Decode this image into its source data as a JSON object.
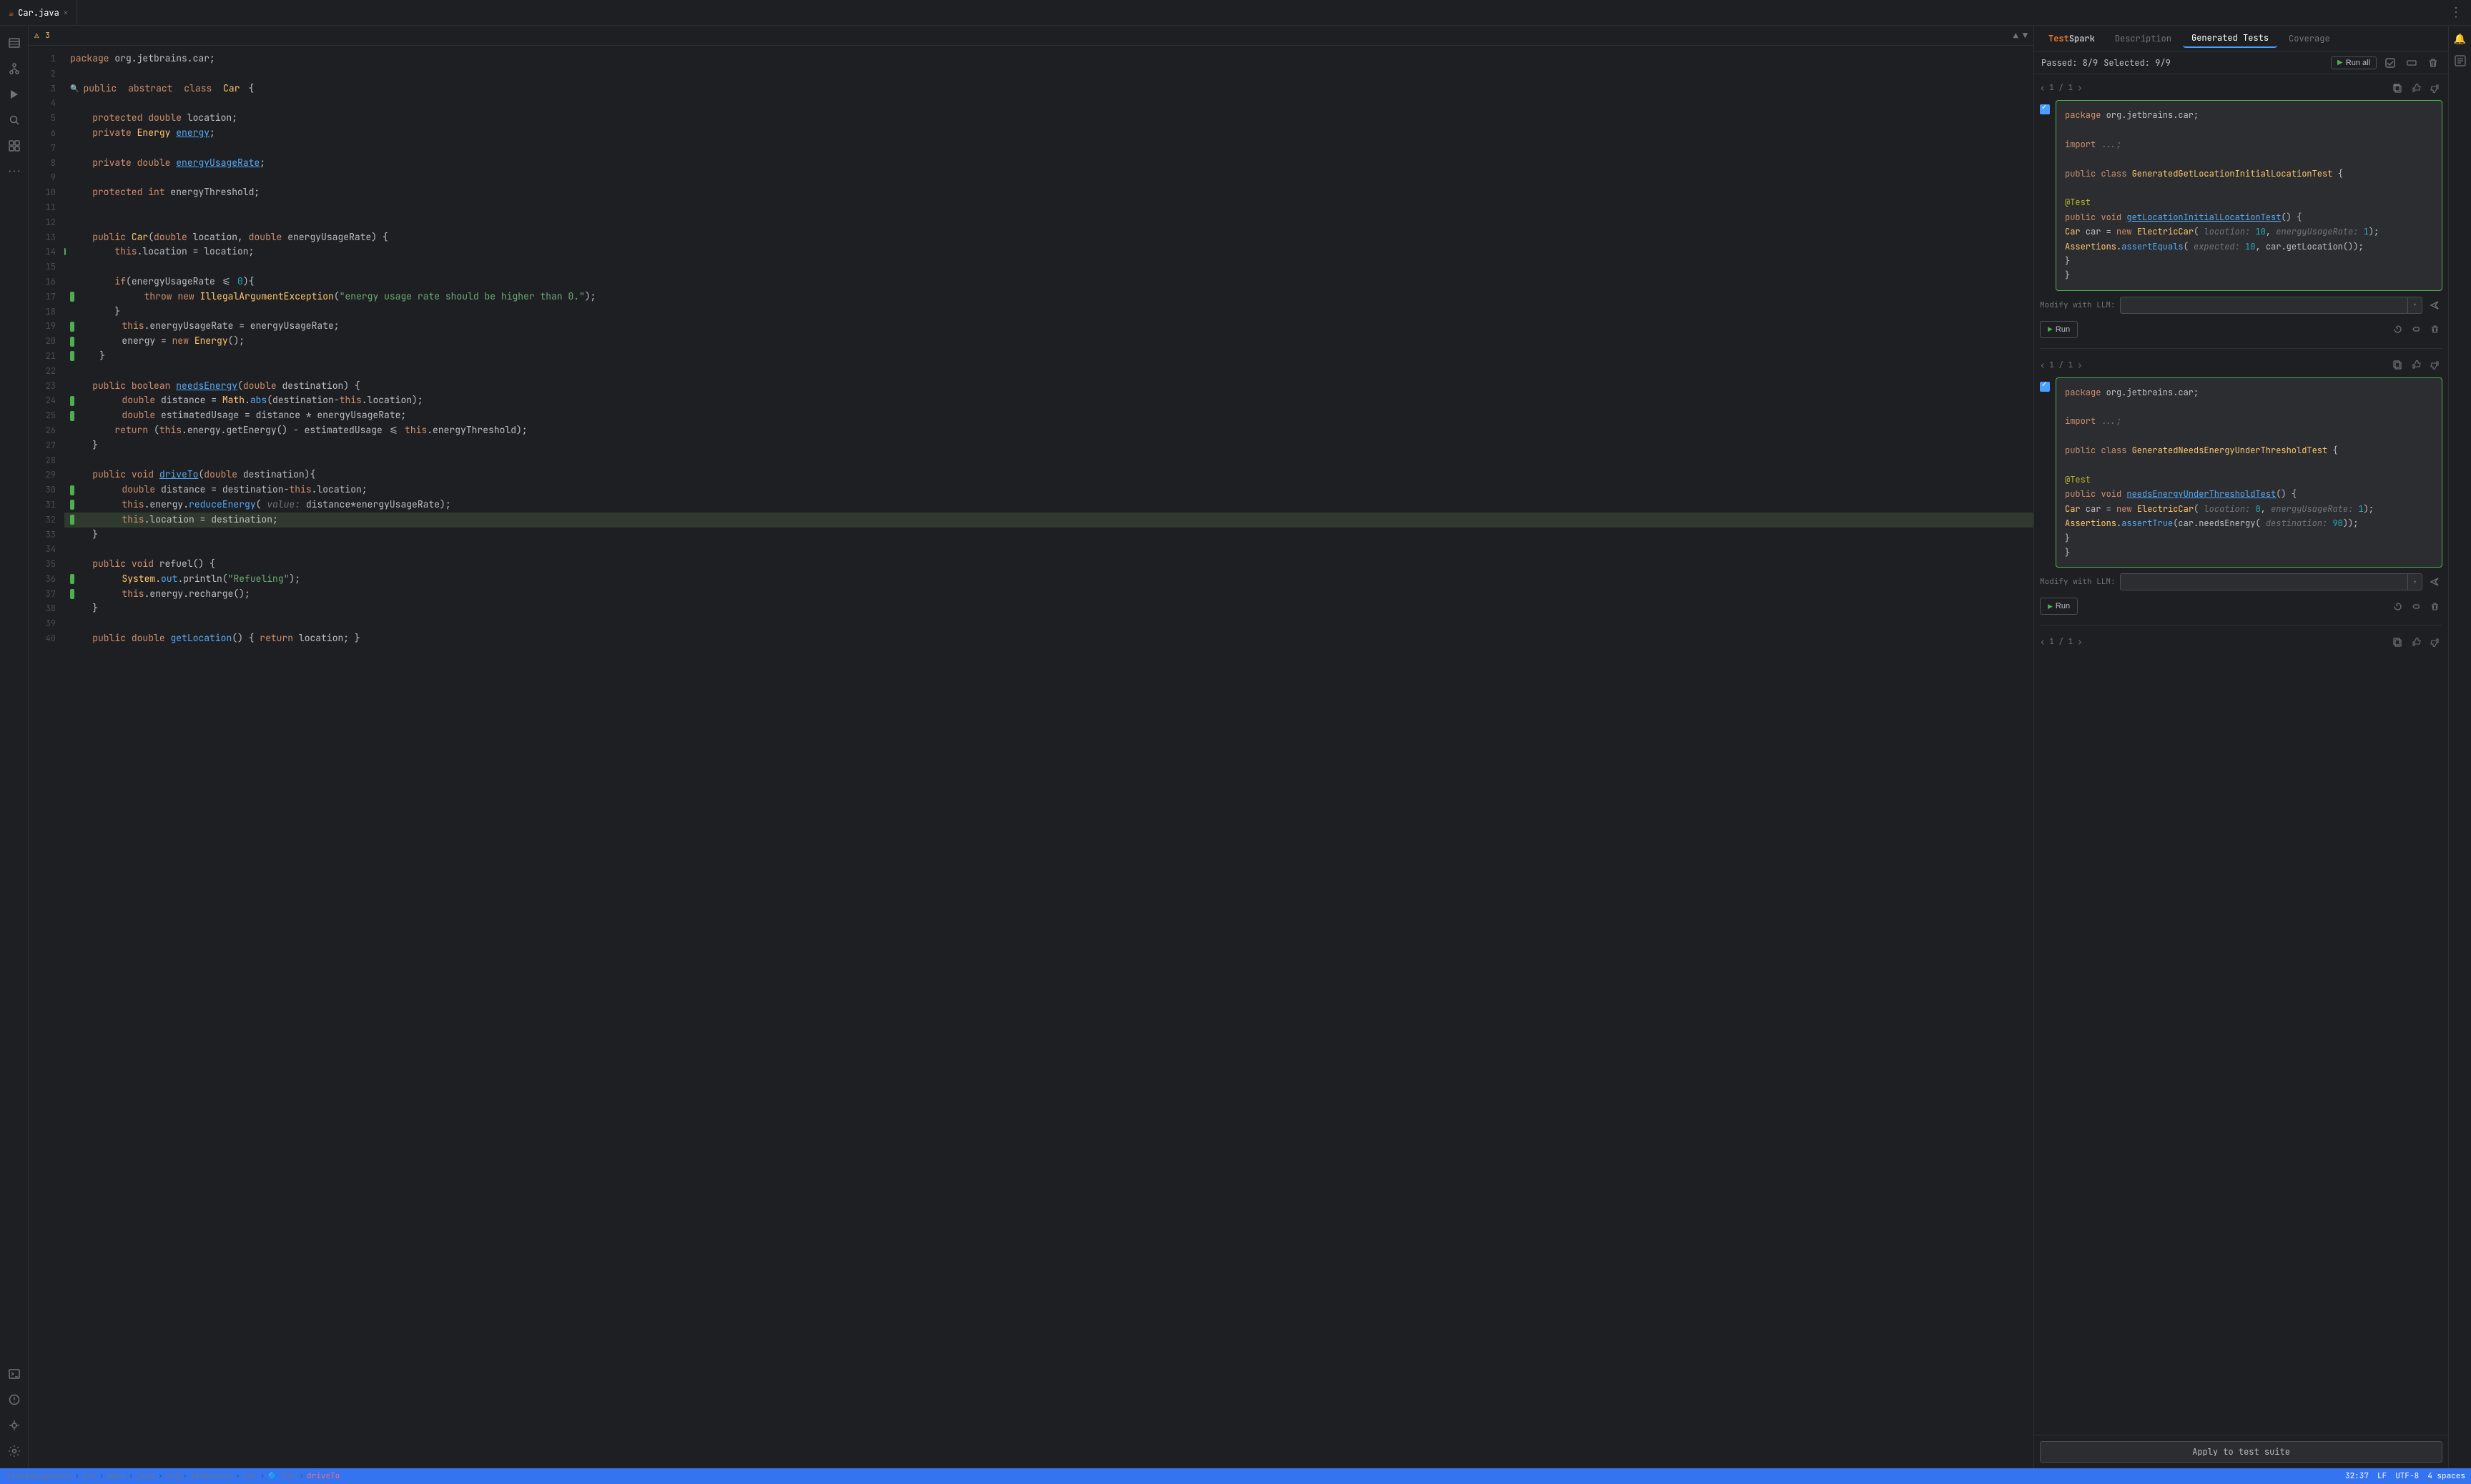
{
  "tabs": [
    {
      "label": "Car.java",
      "icon": "☕",
      "active": true,
      "closable": true
    }
  ],
  "editor": {
    "warning_count": "3",
    "lines": [
      {
        "num": 1,
        "text": "package org.jetbrains.car;",
        "mark": ""
      },
      {
        "num": 2,
        "text": "",
        "mark": ""
      },
      {
        "num": 3,
        "text": "public abstract class Car {",
        "mark": ""
      },
      {
        "num": 4,
        "text": "",
        "mark": ""
      },
      {
        "num": 5,
        "text": "    protected double location;",
        "mark": ""
      },
      {
        "num": 6,
        "text": "    private Energy energy;",
        "mark": ""
      },
      {
        "num": 7,
        "text": "",
        "mark": ""
      },
      {
        "num": 8,
        "text": "    private double energyUsageRate;",
        "mark": ""
      },
      {
        "num": 9,
        "text": "",
        "mark": ""
      },
      {
        "num": 10,
        "text": "    protected int energyThreshold;",
        "mark": ""
      },
      {
        "num": 11,
        "text": "",
        "mark": ""
      },
      {
        "num": 12,
        "text": "",
        "mark": ""
      },
      {
        "num": 13,
        "text": "    public Car(double location, double energyUsageRate) {",
        "mark": ""
      },
      {
        "num": 14,
        "text": "        this.location = location;",
        "mark": "green"
      },
      {
        "num": 15,
        "text": "",
        "mark": ""
      },
      {
        "num": 16,
        "text": "        if(energyUsageRate <= 0){",
        "mark": ""
      },
      {
        "num": 17,
        "text": "            throw new IllegalArgumentException(\"energy usage rate should be higher than 0.\");",
        "mark": "green"
      },
      {
        "num": 18,
        "text": "        }",
        "mark": ""
      },
      {
        "num": 19,
        "text": "        this.energyUsageRate = energyUsageRate;",
        "mark": "green"
      },
      {
        "num": 20,
        "text": "        energy = new Energy();",
        "mark": "green"
      },
      {
        "num": 21,
        "text": "    }",
        "mark": "green"
      },
      {
        "num": 22,
        "text": "",
        "mark": ""
      },
      {
        "num": 23,
        "text": "    public boolean needsEnergy(double destination) {",
        "mark": ""
      },
      {
        "num": 24,
        "text": "        double distance = Math.abs(destination-this.location);",
        "mark": "green"
      },
      {
        "num": 25,
        "text": "        double estimatedUsage = distance * energyUsageRate;",
        "mark": "green"
      },
      {
        "num": 26,
        "text": "        return (this.energy.getEnergy() - estimatedUsage <= this.energyThreshold);",
        "mark": ""
      },
      {
        "num": 27,
        "text": "    }",
        "mark": ""
      },
      {
        "num": 28,
        "text": "",
        "mark": ""
      },
      {
        "num": 29,
        "text": "    public void driveTo(double destination){",
        "mark": ""
      },
      {
        "num": 30,
        "text": "        double distance = destination-this.location;",
        "mark": "green"
      },
      {
        "num": 31,
        "text": "        this.energy.reduceEnergy( value: distance*energyUsageRate);",
        "mark": "green"
      },
      {
        "num": 32,
        "text": "        this.location = destination;",
        "mark": "green"
      },
      {
        "num": 33,
        "text": "    }",
        "mark": ""
      },
      {
        "num": 34,
        "text": "",
        "mark": ""
      },
      {
        "num": 35,
        "text": "    public void refuel() {",
        "mark": ""
      },
      {
        "num": 36,
        "text": "        System.out.println(\"Refueling\");",
        "mark": "green"
      },
      {
        "num": 37,
        "text": "        this.energy.recharge();",
        "mark": "green"
      },
      {
        "num": 38,
        "text": "    }",
        "mark": ""
      },
      {
        "num": 39,
        "text": "",
        "mark": ""
      },
      {
        "num": 40,
        "text": "    public double getLocation() { return location; }",
        "mark": ""
      }
    ]
  },
  "right_panel": {
    "tabs": [
      {
        "label": "TestSpark",
        "active": false
      },
      {
        "label": "Description",
        "active": false
      },
      {
        "label": "Generated Tests",
        "active": true
      },
      {
        "label": "Coverage",
        "active": false
      }
    ],
    "header": {
      "passed": "Passed: 8/9",
      "selected": "Selected: 9/9",
      "run_all_label": "Run all"
    },
    "test_cards": [
      {
        "nav": "1 / 1",
        "code": [
          "package org.jetbrains.car;",
          "",
          "import ...;",
          "",
          "public class GeneratedGetLocationInitialLocationTest {",
          "",
          "    @Test",
          "    public void getLocationInitialLocationTest() {",
          "        Car car = new ElectricCar( location:  10,  energyUsageRate: 1);",
          "        Assertions.assertEquals( expected: 10, car.getLocation());",
          "    }",
          "}"
        ],
        "modify_label": "Modify with LLM:",
        "run_label": "Run",
        "checked": true
      },
      {
        "nav": "1 / 1",
        "code": [
          "package org.jetbrains.car;",
          "",
          "import ...;",
          "",
          "public class GeneratedNeedsEnergyUnderThresholdTest {",
          "",
          "    @Test",
          "    public void needsEnergyUnderThresholdTest() {",
          "        Car car = new ElectricCar( location:  0,  energyUsageRate: 1);",
          "        Assertions.assertTrue(car.needsEnergy( destination:  90));",
          "    }",
          "}"
        ],
        "modify_label": "Modify with LLM:",
        "run_label": "Run",
        "checked": true
      }
    ],
    "third_nav": "1 / 1",
    "apply_label": "Apply to test suite"
  },
  "status_bar": {
    "breadcrumb": [
      "TestAssignment",
      "src",
      "main",
      "java",
      "org",
      "jetbrains",
      "car",
      "Car",
      "driveTo"
    ],
    "right": {
      "position": "32:37",
      "line_ending": "LF",
      "encoding": "UTF-8",
      "indent": "4 spaces"
    }
  },
  "sidebar_left": {
    "icons": [
      {
        "name": "file-icon",
        "symbol": "🗂",
        "active": false
      },
      {
        "name": "git-icon",
        "symbol": "⎇",
        "active": false
      },
      {
        "name": "run-icon",
        "symbol": "▶",
        "active": false
      },
      {
        "name": "search-icon",
        "symbol": "🔍",
        "active": false
      },
      {
        "name": "plugin-icon",
        "symbol": "⊞",
        "active": false
      },
      {
        "name": "more-icon",
        "symbol": "···",
        "active": false
      }
    ],
    "bottom_icons": [
      {
        "name": "terminal-icon",
        "symbol": "⌨",
        "active": false
      },
      {
        "name": "problems-icon",
        "symbol": "⚠",
        "active": false
      },
      {
        "name": "git-bottom-icon",
        "symbol": "↑",
        "active": false
      },
      {
        "name": "settings-icon",
        "symbol": "⚙",
        "active": false
      }
    ]
  }
}
